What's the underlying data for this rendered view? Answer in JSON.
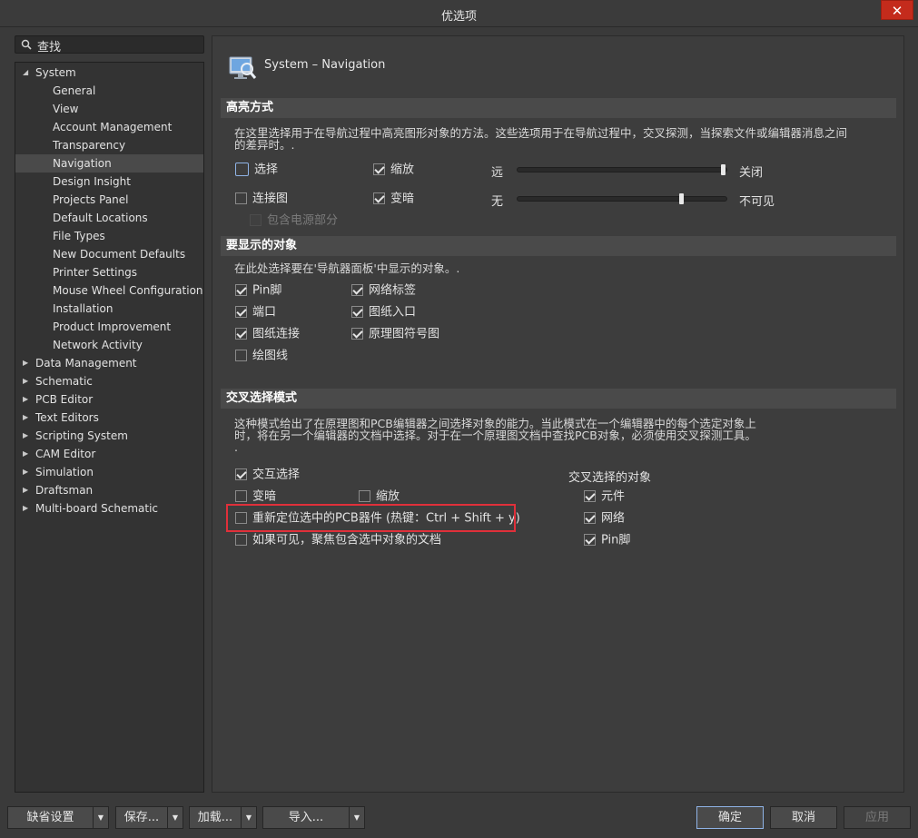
{
  "window": {
    "title": "优选项",
    "close_symbol": "✕"
  },
  "search": {
    "label": "查找"
  },
  "tree": {
    "items": [
      {
        "label": "System",
        "level": 0,
        "expanded": true
      },
      {
        "label": "General",
        "level": 1
      },
      {
        "label": "View",
        "level": 1
      },
      {
        "label": "Account Management",
        "level": 1
      },
      {
        "label": "Transparency",
        "level": 1
      },
      {
        "label": "Navigation",
        "level": 1,
        "selected": true
      },
      {
        "label": "Design Insight",
        "level": 1
      },
      {
        "label": "Projects Panel",
        "level": 1
      },
      {
        "label": "Default Locations",
        "level": 1
      },
      {
        "label": "File Types",
        "level": 1
      },
      {
        "label": "New Document Defaults",
        "level": 1
      },
      {
        "label": "Printer Settings",
        "level": 1
      },
      {
        "label": "Mouse Wheel Configuration",
        "level": 1
      },
      {
        "label": "Installation",
        "level": 1
      },
      {
        "label": "Product Improvement",
        "level": 1
      },
      {
        "label": "Network Activity",
        "level": 1
      },
      {
        "label": "Data Management",
        "level": 0,
        "expanded": false
      },
      {
        "label": "Schematic",
        "level": 0,
        "expanded": false
      },
      {
        "label": "PCB Editor",
        "level": 0,
        "expanded": false
      },
      {
        "label": "Text Editors",
        "level": 0,
        "expanded": false
      },
      {
        "label": "Scripting System",
        "level": 0,
        "expanded": false
      },
      {
        "label": "CAM Editor",
        "level": 0,
        "expanded": false
      },
      {
        "label": "Simulation",
        "level": 0,
        "expanded": false
      },
      {
        "label": "Draftsman",
        "level": 0,
        "expanded": false
      },
      {
        "label": "Multi-board Schematic",
        "level": 0,
        "expanded": false
      }
    ]
  },
  "header": {
    "title": "System – Navigation"
  },
  "highlight": {
    "title": "高亮方式",
    "desc_line1": "在这里选择用于在导航过程中高亮图形对象的方法。这些选项用于在导航过程中，交叉探测，当探索文件或编辑器消息之间",
    "desc_line2": "的差异时。.",
    "select": {
      "label": "选择",
      "checked": false
    },
    "zoom": {
      "label": "缩放",
      "checked": true
    },
    "connect": {
      "label": "连接图",
      "checked": false
    },
    "dim": {
      "label": "变暗",
      "checked": true
    },
    "include_power": {
      "label": "包含电源部分",
      "checked": false
    },
    "slider1": {
      "left": "远",
      "right": "关闭",
      "value": 1.0
    },
    "slider2": {
      "left": "无",
      "right": "不可见",
      "value": 0.79
    }
  },
  "objects": {
    "title": "要显示的对象",
    "desc": "在此处选择要在'导航器面板'中显示的对象。.",
    "pin": {
      "label": "Pin脚",
      "checked": true
    },
    "net_label": {
      "label": "网络标签",
      "checked": true
    },
    "port": {
      "label": "端口",
      "checked": true
    },
    "sheet_entry": {
      "label": "图纸入口",
      "checked": true
    },
    "sheet_connector": {
      "label": "图纸连接",
      "checked": true
    },
    "sheet_symbol": {
      "label": "原理图符号图",
      "checked": true
    },
    "graphic_lines": {
      "label": "绘图线",
      "checked": false
    }
  },
  "cross": {
    "title": "交叉选择模式",
    "desc_line1": "这种模式给出了在原理图和PCB编辑器之间选择对象的能力。当此模式在一个编辑器中的每个选定对象上",
    "desc_line2": "时，将在另一个编辑器的文档中选择。对于在一个原理图文档中查找PCB对象，必须使用交叉探测工具。",
    "desc_line3": ".",
    "interactive": {
      "label": "交互选择",
      "checked": true
    },
    "dim": {
      "label": "变暗",
      "checked": false
    },
    "zoom": {
      "label": "缩放",
      "checked": false
    },
    "reposition": {
      "label": "重新定位选中的PCB器件 (热键：Ctrl + Shift + y)",
      "checked": false
    },
    "focus_doc": {
      "label": "如果可见，聚焦包含选中对象的文档",
      "checked": false
    },
    "objects_title": "交叉选择的对象",
    "component": {
      "label": "元件",
      "checked": true
    },
    "net": {
      "label": "网络",
      "checked": true
    },
    "pin": {
      "label": "Pin脚",
      "checked": true
    }
  },
  "footer": {
    "defaults": "缺省设置",
    "save": "保存...",
    "load": "加载...",
    "import": "导入...",
    "ok": "确定",
    "cancel": "取消",
    "apply": "应用",
    "arrow": "▼"
  }
}
